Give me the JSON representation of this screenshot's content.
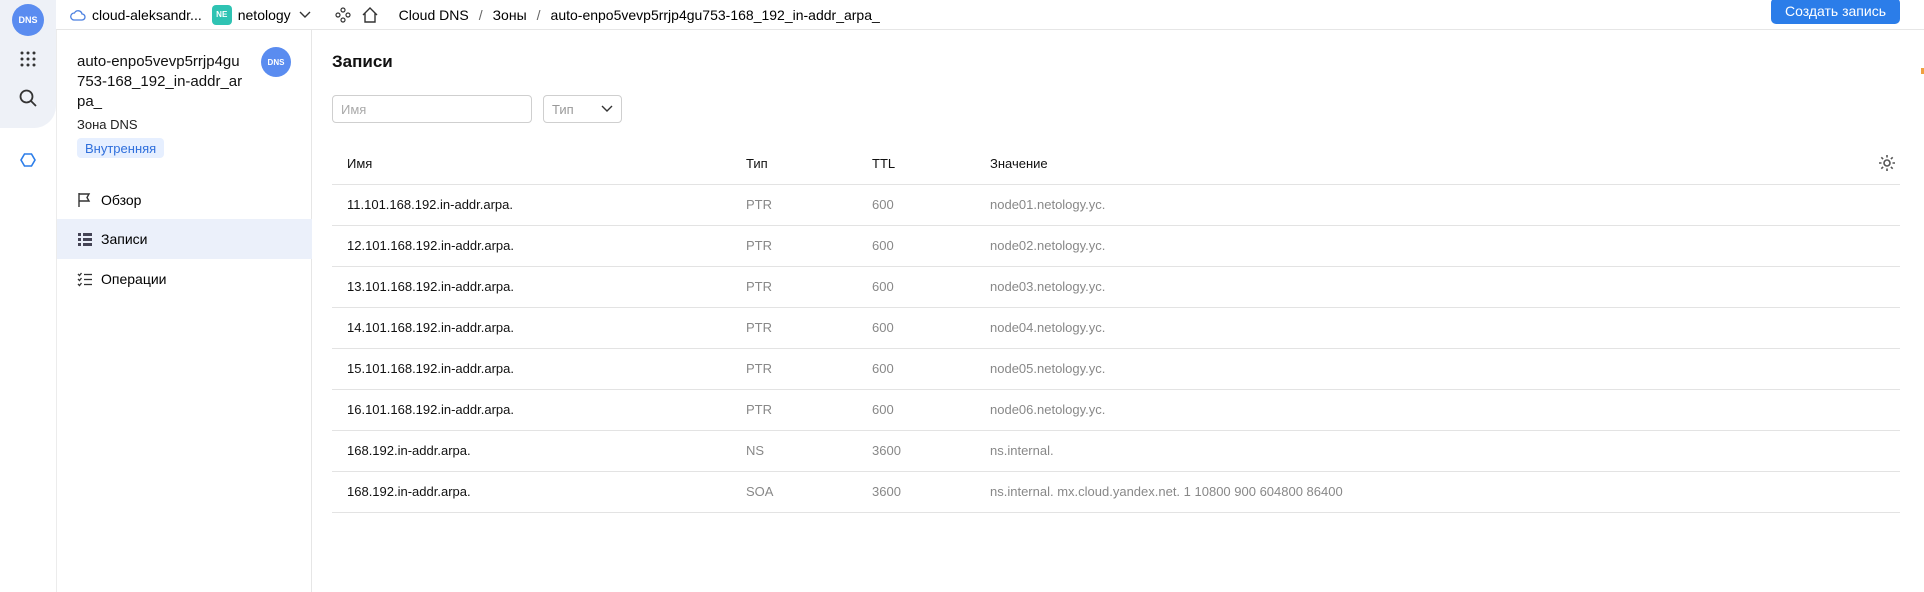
{
  "rail": {
    "badge": "DNS"
  },
  "topbar": {
    "cloud": "cloud-aleksandr...",
    "folder_chip": "NE",
    "folder": "netology",
    "breadcrumbs": [
      "Cloud DNS",
      "Зоны",
      "auto-enpo5vevp5rrjp4gu753-168_192_in-addr_arpa_"
    ],
    "create_button": "Создать запись"
  },
  "sidebar": {
    "zone_name": "auto-enpo5vevp5rrjp4gu753-168_192_in-addr_arpa_",
    "badge": "DNS",
    "zone_type": "Зона DNS",
    "zone_tag": "Внутренняя",
    "items": [
      {
        "label": "Обзор"
      },
      {
        "label": "Записи"
      },
      {
        "label": "Операции"
      }
    ]
  },
  "main": {
    "title": "Записи",
    "search_placeholder": "Имя",
    "type_placeholder": "Тип",
    "columns": [
      "Имя",
      "Тип",
      "TTL",
      "Значение"
    ],
    "rows": [
      {
        "name": "11.101.168.192.in-addr.arpa.",
        "type": "PTR",
        "ttl": "600",
        "value": "node01.netology.yc."
      },
      {
        "name": "12.101.168.192.in-addr.arpa.",
        "type": "PTR",
        "ttl": "600",
        "value": "node02.netology.yc."
      },
      {
        "name": "13.101.168.192.in-addr.arpa.",
        "type": "PTR",
        "ttl": "600",
        "value": "node03.netology.yc."
      },
      {
        "name": "14.101.168.192.in-addr.arpa.",
        "type": "PTR",
        "ttl": "600",
        "value": "node04.netology.yc."
      },
      {
        "name": "15.101.168.192.in-addr.arpa.",
        "type": "PTR",
        "ttl": "600",
        "value": "node05.netology.yc."
      },
      {
        "name": "16.101.168.192.in-addr.arpa.",
        "type": "PTR",
        "ttl": "600",
        "value": "node06.netology.yc."
      },
      {
        "name": "168.192.in-addr.arpa.",
        "type": "NS",
        "ttl": "3600",
        "value": "ns.internal."
      },
      {
        "name": "168.192.in-addr.arpa.",
        "type": "SOA",
        "ttl": "3600",
        "value": "ns.internal. mx.cloud.yandex.net. 1 10800 900 604800 86400"
      }
    ]
  }
}
